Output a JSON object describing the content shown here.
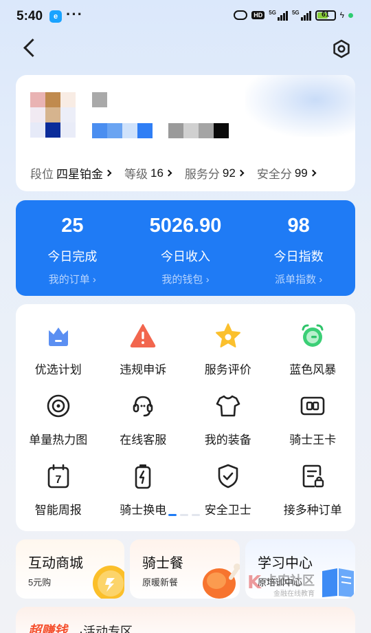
{
  "status_bar": {
    "time": "5:40",
    "hd_label": "HD",
    "network_1": "5G",
    "network_2": "5G",
    "battery": "61",
    "battery_color": "#8ad03a"
  },
  "nav": {
    "back_icon": "chevron-left-icon",
    "settings_icon": "hexagon-settings-icon"
  },
  "profile": {
    "stats": [
      {
        "label": "段位",
        "value": "四星铂金"
      },
      {
        "label": "等级",
        "value": "16"
      },
      {
        "label": "服务分",
        "value": "92"
      },
      {
        "label": "安全分",
        "value": "99"
      }
    ]
  },
  "summary": {
    "accent": "#1f7bf5",
    "items": [
      {
        "value": "25",
        "label": "今日完成",
        "link": "我的订单"
      },
      {
        "value": "5026.90",
        "label": "今日收入",
        "link": "我的钱包"
      },
      {
        "value": "98",
        "label": "今日指数",
        "link": "派单指数"
      }
    ]
  },
  "grid": {
    "items": [
      {
        "label": "优选计划",
        "icon": "crown-icon"
      },
      {
        "label": "违规申诉",
        "icon": "warning-icon"
      },
      {
        "label": "服务评价",
        "icon": "star-icon"
      },
      {
        "label": "蓝色风暴",
        "icon": "alarm-clock-icon"
      },
      {
        "label": "单量热力图",
        "icon": "target-icon"
      },
      {
        "label": "在线客服",
        "icon": "headset-icon"
      },
      {
        "label": "我的装备",
        "icon": "shirt-icon"
      },
      {
        "label": "骑士王卡",
        "icon": "card-icon"
      },
      {
        "label": "智能周报",
        "icon": "calendar-icon"
      },
      {
        "label": "骑士换电",
        "icon": "battery-icon"
      },
      {
        "label": "安全卫士",
        "icon": "shield-icon"
      },
      {
        "label": "接多种订单",
        "icon": "document-lock-icon"
      }
    ],
    "page_count": 3,
    "active_page": 1
  },
  "promos": [
    {
      "title": "互动商城",
      "subtitle": "5元购"
    },
    {
      "title": "骑士餐",
      "subtitle": "原暖新餐"
    },
    {
      "title": "学习中心",
      "subtitle": "原培训中心"
    }
  ],
  "activity": {
    "title_highlight": "超赚钱",
    "title": "·活动专区"
  },
  "watermark": {
    "brand": "卡农社区",
    "slogan": "金融在线教育"
  }
}
